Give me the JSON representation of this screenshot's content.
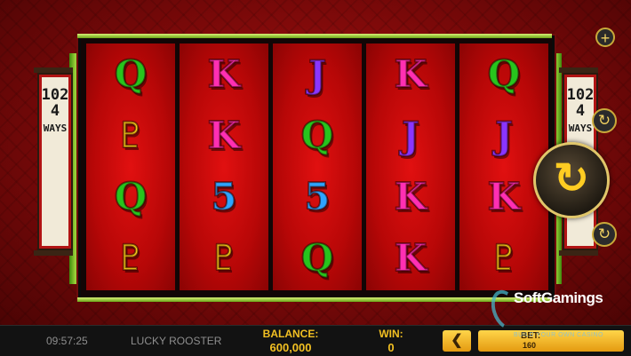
{
  "scroll": {
    "left_text": "1024",
    "left_ways": "WAYS",
    "right_text": "1024",
    "right_ways": "WAYS"
  },
  "reels": [
    [
      "Q",
      "roof",
      "Q",
      "roof"
    ],
    [
      "K",
      "K",
      "5",
      "roof"
    ],
    [
      "J",
      "Q",
      "5",
      "Q"
    ],
    [
      "K",
      "J",
      "K",
      "K"
    ],
    [
      "Q",
      "J",
      "K",
      "roof"
    ]
  ],
  "symbol_glyphs": {
    "roof": "♇",
    "Q": "Q",
    "K": "K",
    "J": "J",
    "5": "5"
  },
  "controls": {
    "plus_icon": "+",
    "autoplay_icon": "↻",
    "spin_icon": "↻",
    "turbo_icon": "↻"
  },
  "bottom_bar": {
    "clock": "09:57:25",
    "game_name": "LUCKY ROOSTER",
    "balance_label": "BALANCE:",
    "balance_value": "600,000",
    "win_label": "WIN:",
    "win_value": "0",
    "prev_icon": "❮",
    "bet_label": "BET:",
    "bet_value": "160"
  },
  "watermark": {
    "brand": "SoftGamings",
    "tagline": "BUILD YOUR OWN CASINO"
  },
  "colors": {
    "accent_gold": "#f2c022",
    "reel_red": "#e11010",
    "q_green": "#27c41d",
    "k_pink": "#ff2fb3",
    "j_purple": "#8a35ff",
    "five_blue": "#2ea4ff",
    "roof_yellow": "#ffd21a"
  }
}
